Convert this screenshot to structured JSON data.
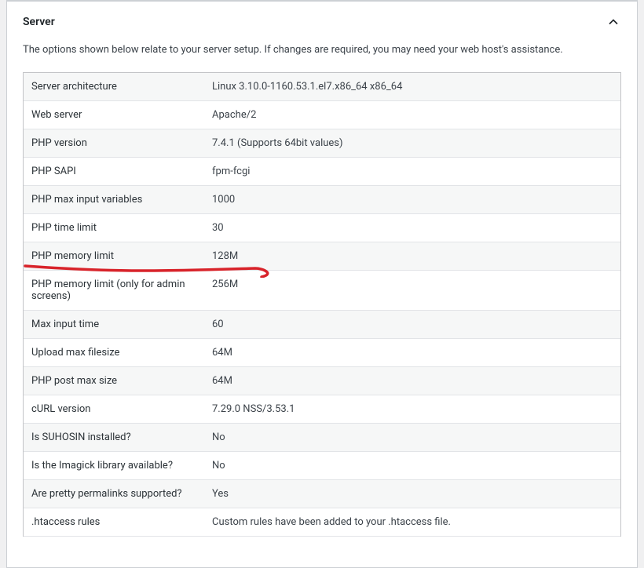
{
  "section": {
    "title": "Server",
    "description": "The options shown below relate to your server setup. If changes are required, you may need your web host's assistance."
  },
  "rows": [
    {
      "label": "Server architecture",
      "value": "Linux 3.10.0-1160.53.1.el7.x86_64 x86_64"
    },
    {
      "label": "Web server",
      "value": "Apache/2"
    },
    {
      "label": "PHP version",
      "value": "7.4.1 (Supports 64bit values)"
    },
    {
      "label": "PHP SAPI",
      "value": "fpm-fcgi"
    },
    {
      "label": "PHP max input variables",
      "value": "1000"
    },
    {
      "label": "PHP time limit",
      "value": "30"
    },
    {
      "label": "PHP memory limit",
      "value": "128M"
    },
    {
      "label": "PHP memory limit (only for admin screens)",
      "value": "256M"
    },
    {
      "label": "Max input time",
      "value": "60"
    },
    {
      "label": "Upload max filesize",
      "value": "64M"
    },
    {
      "label": "PHP post max size",
      "value": "64M"
    },
    {
      "label": "cURL version",
      "value": "7.29.0 NSS/3.53.1"
    },
    {
      "label": "Is SUHOSIN installed?",
      "value": "No"
    },
    {
      "label": "Is the Imagick library available?",
      "value": "No"
    },
    {
      "label": "Are pretty permalinks supported?",
      "value": "Yes"
    },
    {
      "label": ".htaccess rules",
      "value": "Custom rules have been added to your .htaccess file."
    }
  ]
}
